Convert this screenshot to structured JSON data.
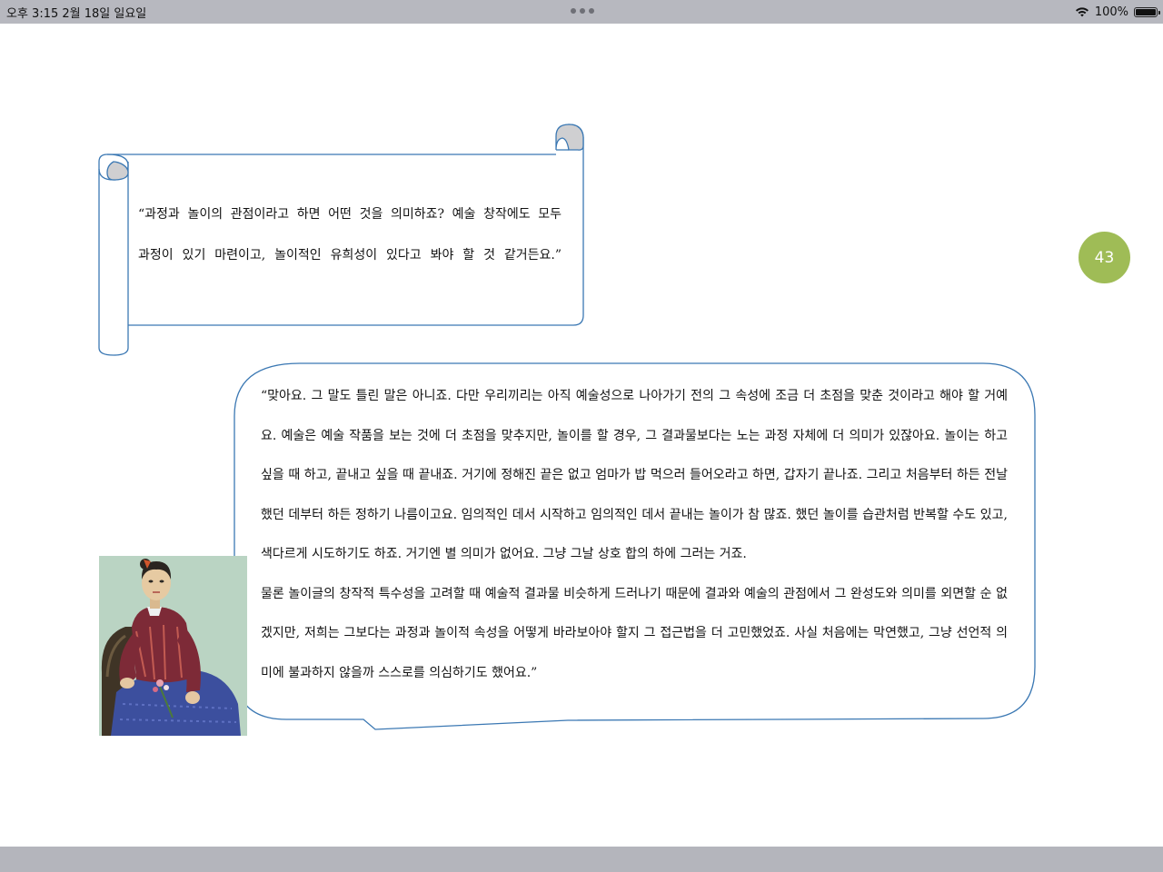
{
  "status_bar": {
    "time_date": "오후 3:15   2월 18일 일요일",
    "battery": "100%",
    "battery_level": 1.0
  },
  "page": {
    "number": "43"
  },
  "scroll_quote": {
    "line1": "“과정과 놀이의 관점이라고 하면 어떤 것을 의미하죠? 예술 창작에도 모두",
    "line2": "과정이 있기 마련이고, 놀이적인 유희성이 있다고 봐야 할 것 같거든요.”"
  },
  "speech_bubble": {
    "paragraph1": "“맞아요. 그 말도 틀린 말은 아니죠. 다만 우리끼리는 아직 예술성으로 나아가기 전의 그 속성에 조금 더 초점을 맞춘 것이라고 해야 할 거예요. 예술은 예술 작품을 보는 것에 더 초점을 맞추지만, 놀이를 할 경우, 그 결과물보다는 노는 과정 자체에 더 의미가 있잖아요. 놀이는 하고 싶을 때 하고, 끝내고 싶을 때 끝내죠. 거기에 정해진 끝은 없고 엄마가 밥 먹으러 들어오라고 하면, 갑자기 끝나죠. 그리고 처음부터 하든 전날 했던 데부터 하든 정하기 나름이고요. 임의적인 데서 시작하고 임의적인 데서 끝내는 놀이가 참 많죠. 했던 놀이를 습관처럼 반복할 수도 있고, 색다르게 시도하기도 하죠. 거기엔 별 의미가 없어요. 그냥 그날 상호 합의 하에 그러는 거죠.",
    "paragraph2": "물론 놀이글의 창작적 특수성을 고려할 때 예술적 결과물 비슷하게 드러나기 때문에 결과와 예술의 관점에서 그 완성도와 의미를 외면할 순 없겠지만, 저희는 그보다는 과정과 놀이적 속성을 어떻게 바라보아야 할지 그 접근법을 더 고민했었죠. 사실 처음에는 막연했고, 그냥 선언적 의미에 불과하지 않을까 스스로를 의심하기도 했어요.”"
  },
  "colors": {
    "outline": "#3b78b3",
    "badge": "#9fbc56",
    "scroll_curl": "#cfcfd1"
  },
  "icons": [
    "wifi-icon",
    "battery-icon",
    "more-dots-icon"
  ]
}
